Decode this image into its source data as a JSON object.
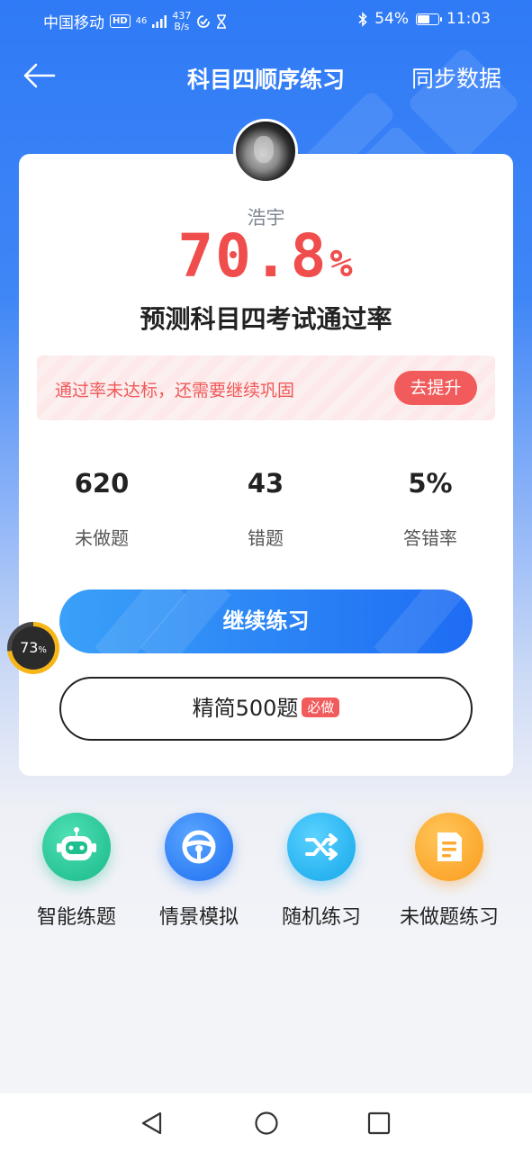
{
  "status_bar": {
    "carrier": "中国移动",
    "hd": "HD",
    "network": "46",
    "speed_value": "437",
    "speed_unit": "B/s",
    "battery": "54%",
    "battery_level": 0.54,
    "time": "11:03"
  },
  "nav": {
    "title": "科目四顺序练习",
    "sync_label": "同步数据"
  },
  "profile": {
    "name": "浩宇",
    "pass_rate": "70.8",
    "pass_rate_unit": "%",
    "predict_label": "预测科目四考试通过率"
  },
  "warning": {
    "text": "通过率未达标，还需要继续巩固",
    "button": "去提升"
  },
  "stats": [
    {
      "value": "620",
      "label": "未做题"
    },
    {
      "value": "43",
      "label": "错题"
    },
    {
      "value": "5%",
      "label": "答错率"
    }
  ],
  "actions": {
    "continue_label": "继续练习",
    "simple_label": "精简500题",
    "simple_badge": "必做"
  },
  "floating_widget": {
    "value": "73",
    "unit": "%",
    "level": 0.73
  },
  "features": [
    {
      "label": "智能练题",
      "icon": "robot-icon",
      "color": "#25c79a"
    },
    {
      "label": "情景模拟",
      "icon": "steering-wheel-icon",
      "color": "#2f86f6"
    },
    {
      "label": "随机练习",
      "icon": "shuffle-icon",
      "color": "#22b7f0"
    },
    {
      "label": "未做题练习",
      "icon": "document-icon",
      "color": "#fca62a"
    }
  ]
}
